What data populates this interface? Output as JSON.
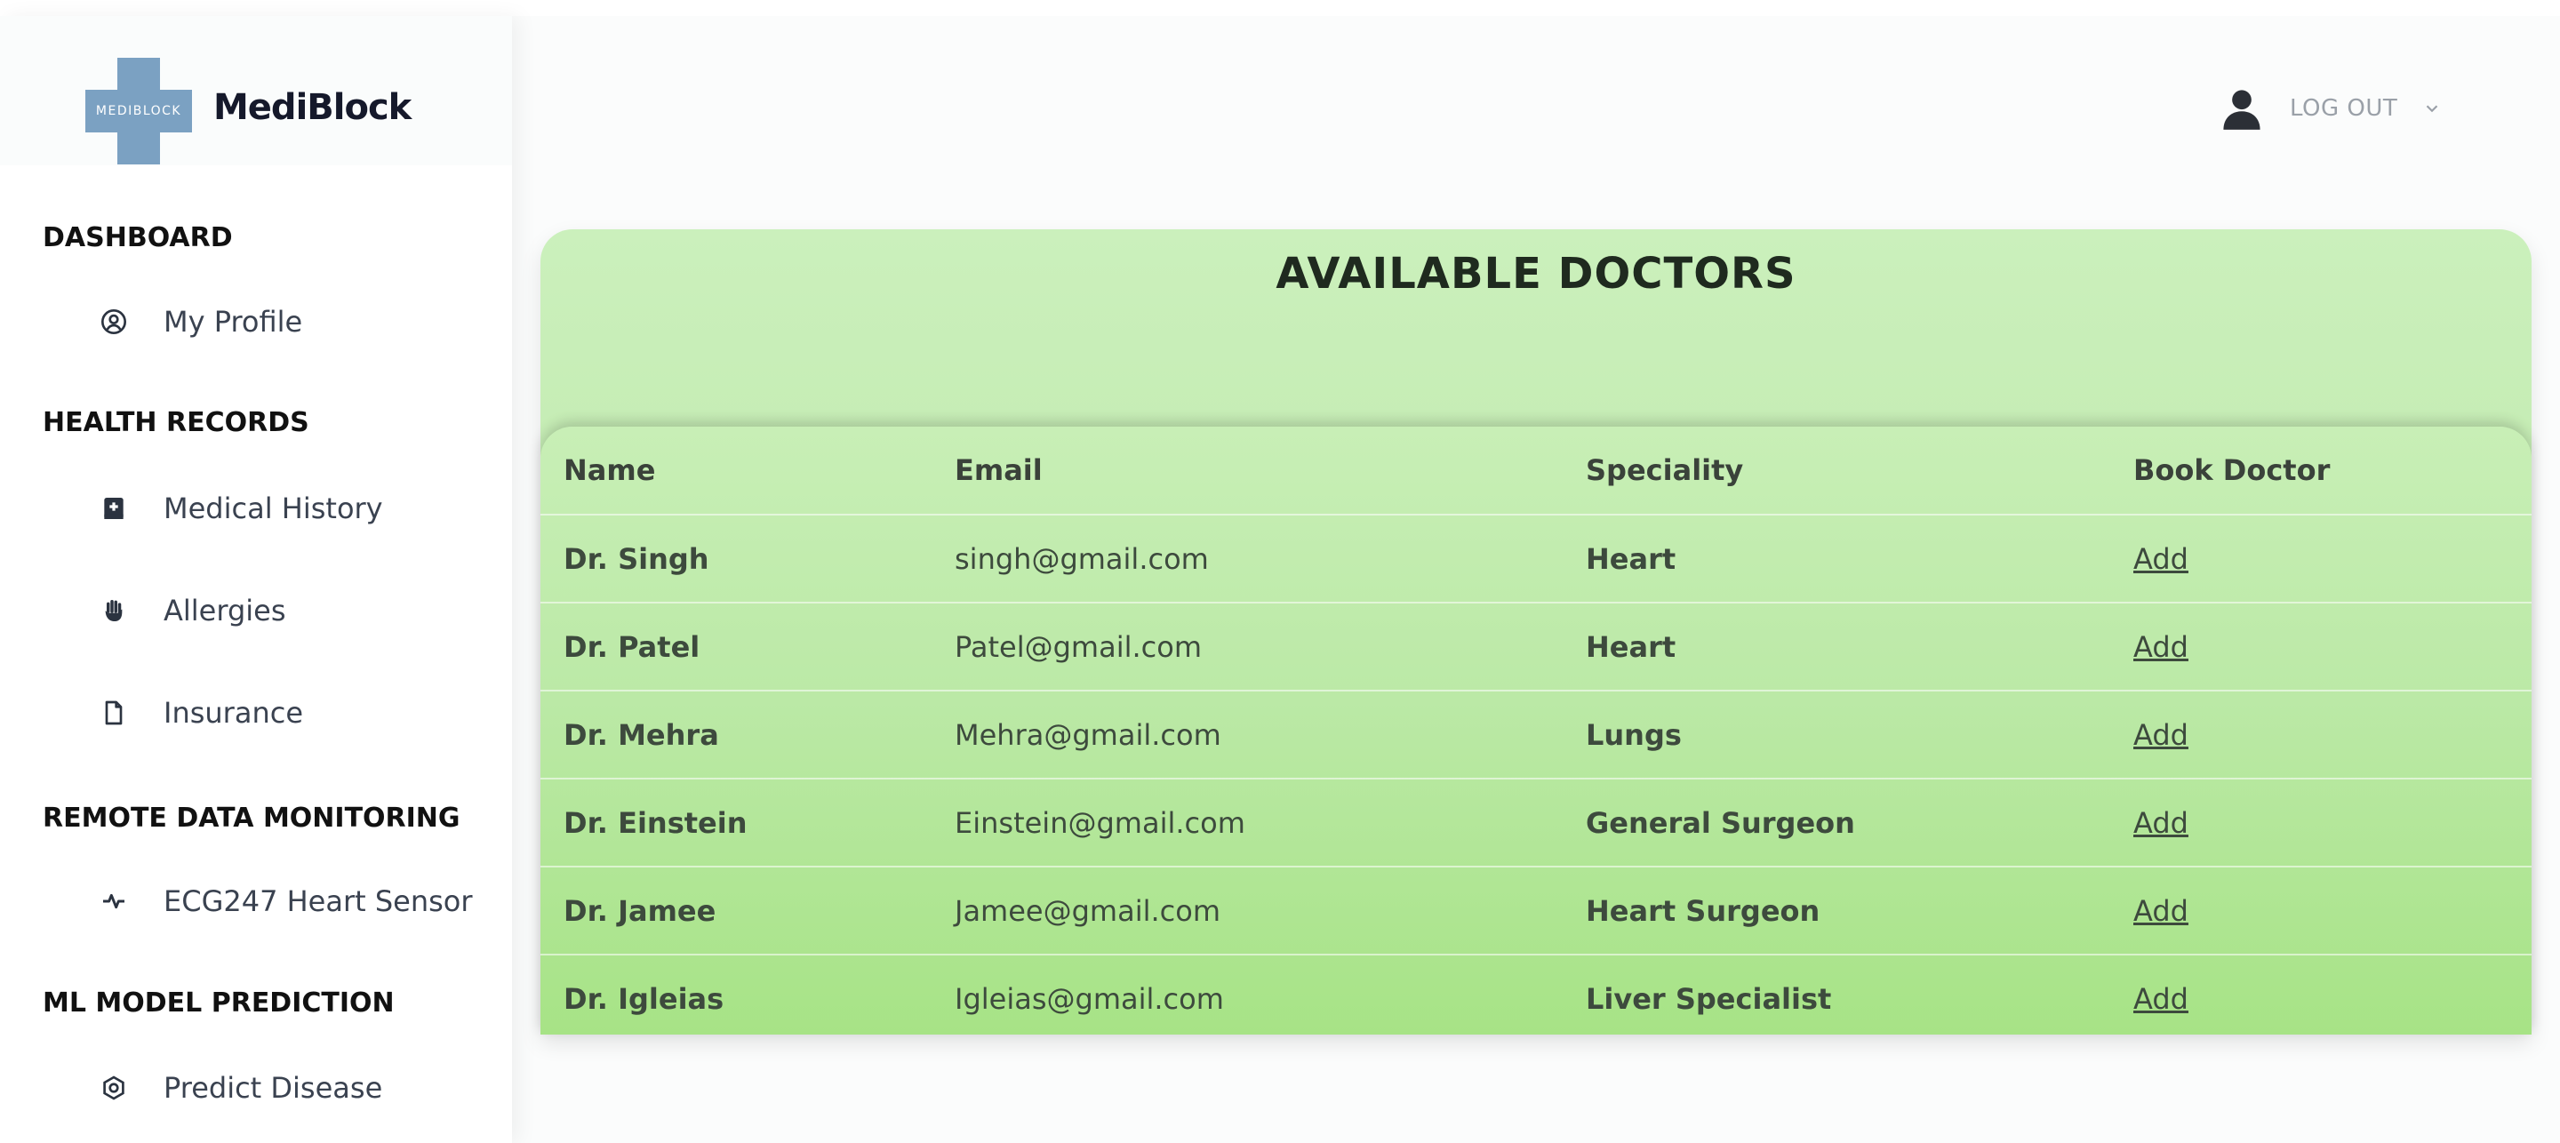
{
  "brand": {
    "logo_text": "MEDIBLOCK",
    "name": "MediBlock",
    "color": "#7ba1c2"
  },
  "sidebar": {
    "sections": [
      {
        "title": "DASHBOARD",
        "items": [
          {
            "label": "My Profile",
            "icon": "user-circle-icon"
          }
        ]
      },
      {
        "title": "HEALTH RECORDS",
        "items": [
          {
            "label": "Medical History",
            "icon": "medical-book-icon"
          },
          {
            "label": "Allergies",
            "icon": "hand-icon"
          },
          {
            "label": "Insurance",
            "icon": "file-icon"
          }
        ]
      },
      {
        "title": "REMOTE DATA MONITORING",
        "items": [
          {
            "label": "ECG247 Heart Sensor",
            "icon": "pulse-icon"
          }
        ]
      },
      {
        "title": "ML MODEL PREDICTION",
        "items": [
          {
            "label": "Predict Disease",
            "icon": "gear-icon"
          }
        ]
      }
    ]
  },
  "header": {
    "logout_label": "LOG OUT",
    "avatar_icon": "user-avatar-icon",
    "chevron_icon": "chevron-down-icon"
  },
  "main": {
    "title": "AVAILABLE DOCTORS",
    "table": {
      "headers": [
        "Name",
        "Email",
        "Speciality",
        "Book Doctor"
      ],
      "rows": [
        {
          "name": "Dr. Singh",
          "email": "singh@gmail.com",
          "speciality": "Heart",
          "action": "Add"
        },
        {
          "name": "Dr. Patel",
          "email": "Patel@gmail.com",
          "speciality": "Heart",
          "action": "Add"
        },
        {
          "name": "Dr. Mehra",
          "email": "Mehra@gmail.com",
          "speciality": "Lungs",
          "action": "Add"
        },
        {
          "name": "Dr. Einstein",
          "email": "Einstein@gmail.com",
          "speciality": "General Surgeon",
          "action": "Add"
        },
        {
          "name": "Dr. Jamee",
          "email": "Jamee@gmail.com",
          "speciality": "Heart Surgeon",
          "action": "Add"
        },
        {
          "name": "Dr. Igleias",
          "email": "Igleias@gmail.com",
          "speciality": "Liver Specialist",
          "action": "Add"
        }
      ]
    },
    "card_colors": {
      "top": "#cbf0bc",
      "bottom": "#ade58f"
    }
  }
}
